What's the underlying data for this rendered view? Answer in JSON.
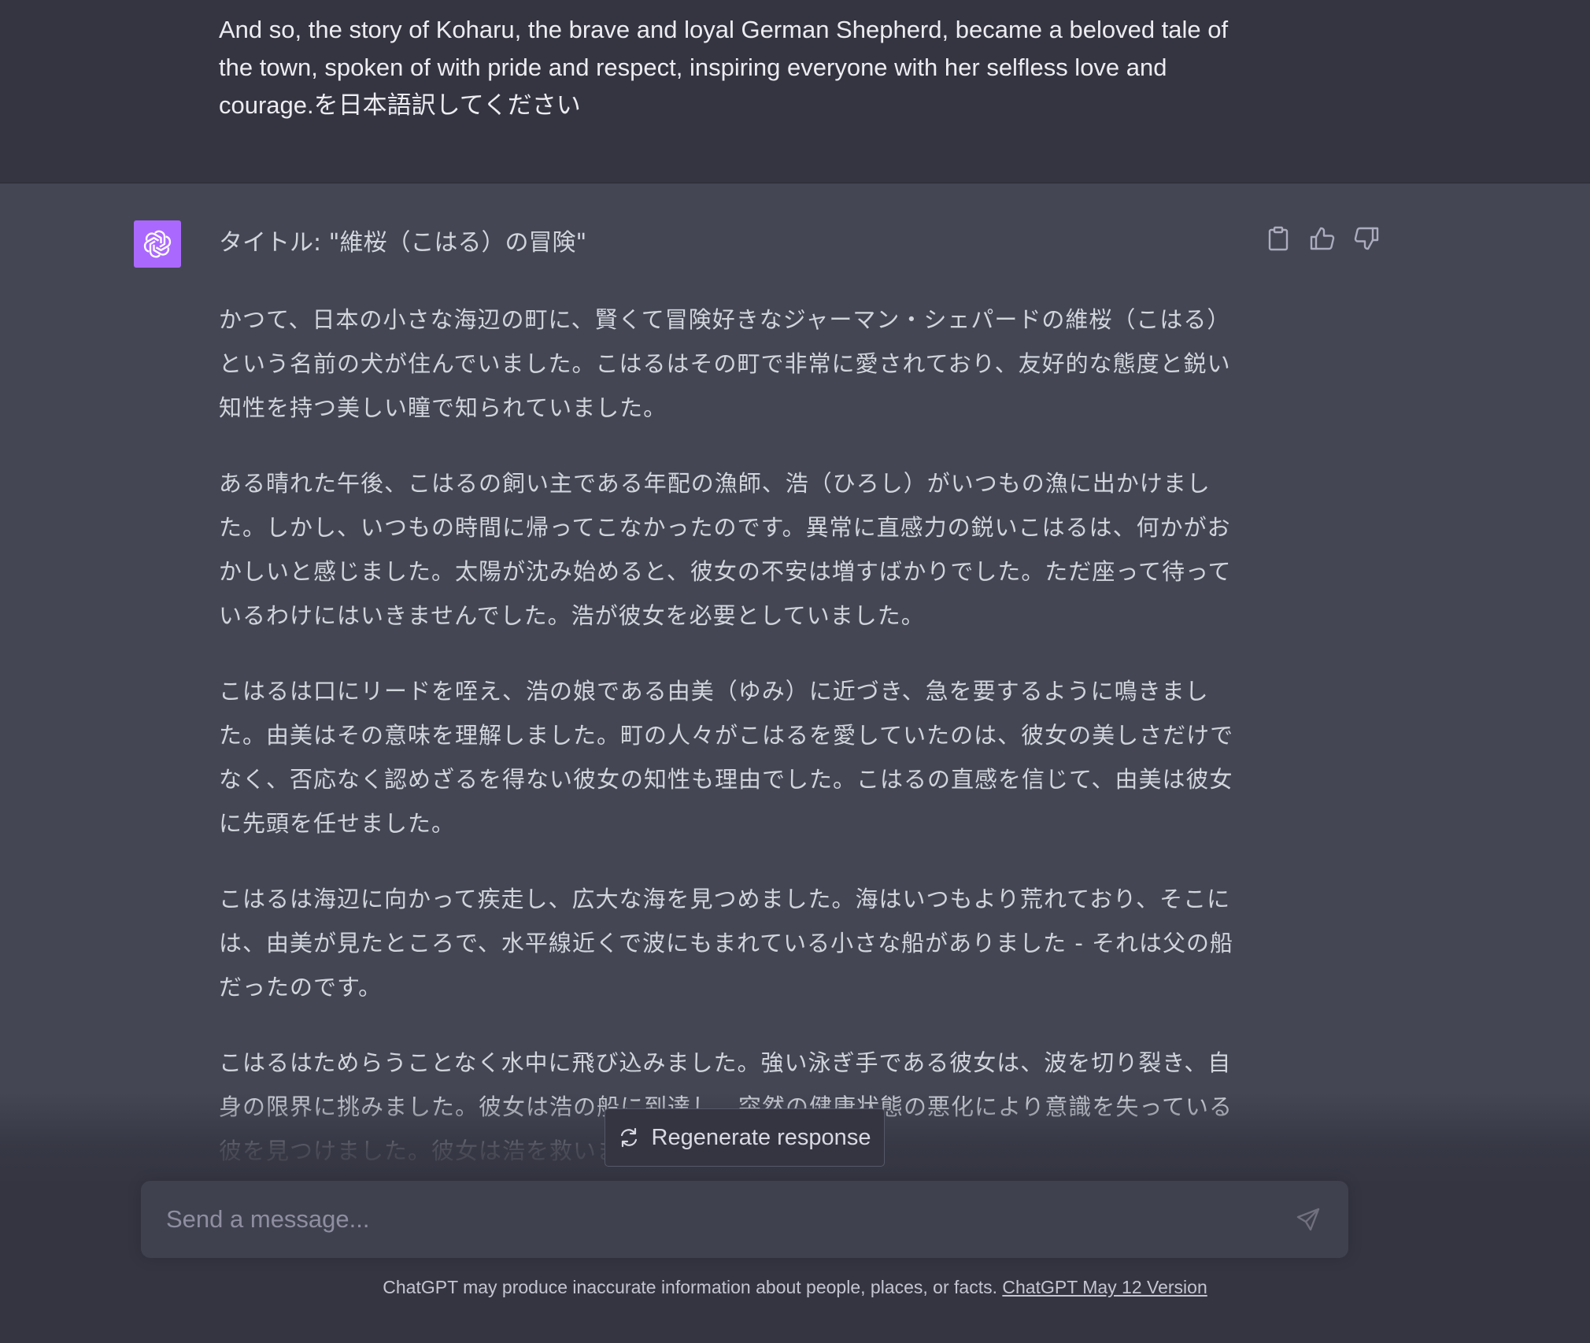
{
  "user_message": {
    "text": "And so, the story of Koharu, the brave and loyal German Shepherd, became a beloved tale of the town, spoken of with pride and respect, inspiring everyone with her selfless love and courage.を日本語訳してください"
  },
  "assistant_message": {
    "title": "タイトル: \"維桜（こはる）の冒険\"",
    "paragraphs": [
      "かつて、日本の小さな海辺の町に、賢くて冒険好きなジャーマン・シェパードの維桜（こはる）という名前の犬が住んでいました。こはるはその町で非常に愛されており、友好的な態度と鋭い知性を持つ美しい瞳で知られていました。",
      "ある晴れた午後、こはるの飼い主である年配の漁師、浩（ひろし）がいつもの漁に出かけました。しかし、いつもの時間に帰ってこなかったのです。異常に直感力の鋭いこはるは、何かがおかしいと感じました。太陽が沈み始めると、彼女の不安は増すばかりでした。ただ座って待っているわけにはいきませんでした。浩が彼女を必要としていました。",
      "こはるは口にリードを咥え、浩の娘である由美（ゆみ）に近づき、急を要するように鳴きました。由美はその意味を理解しました。町の人々がこはるを愛していたのは、彼女の美しさだけでなく、否応なく認めざるを得ない彼女の知性も理由でした。こはるの直感を信じて、由美は彼女に先頭を任せました。",
      "こはるは海辺に向かって疾走し、広大な海を見つめました。海はいつもより荒れており、そこには、由美が見たところで、水平線近くで波にもまれている小さな船がありました - それは父の船だったのです。",
      "こはるはためらうことなく水中に飛び込みました。強い泳ぎ手である彼女は、波を切り裂き、自身の限界に挑みました。彼女は浩の船に到達し、突然の健康状態の悪化により意識を失っている彼を見つけました。彼女は浩を救いました。"
    ]
  },
  "actions": {
    "copy_icon": "clipboard-icon",
    "like_icon": "thumbs-up-icon",
    "dislike_icon": "thumbs-down-icon"
  },
  "regenerate": {
    "label": "Regenerate response",
    "icon": "refresh-icon"
  },
  "composer": {
    "placeholder": "Send a message...",
    "send_icon": "paper-plane-icon"
  },
  "footer": {
    "disclaimer": "ChatGPT may produce inaccurate information about people, places, or facts. ",
    "version_link": "ChatGPT May 12 Version"
  },
  "colors": {
    "user_bg": "#343541",
    "assistant_bg": "#444654",
    "avatar_bg": "#ab68ff",
    "text": "#d1d5db"
  }
}
